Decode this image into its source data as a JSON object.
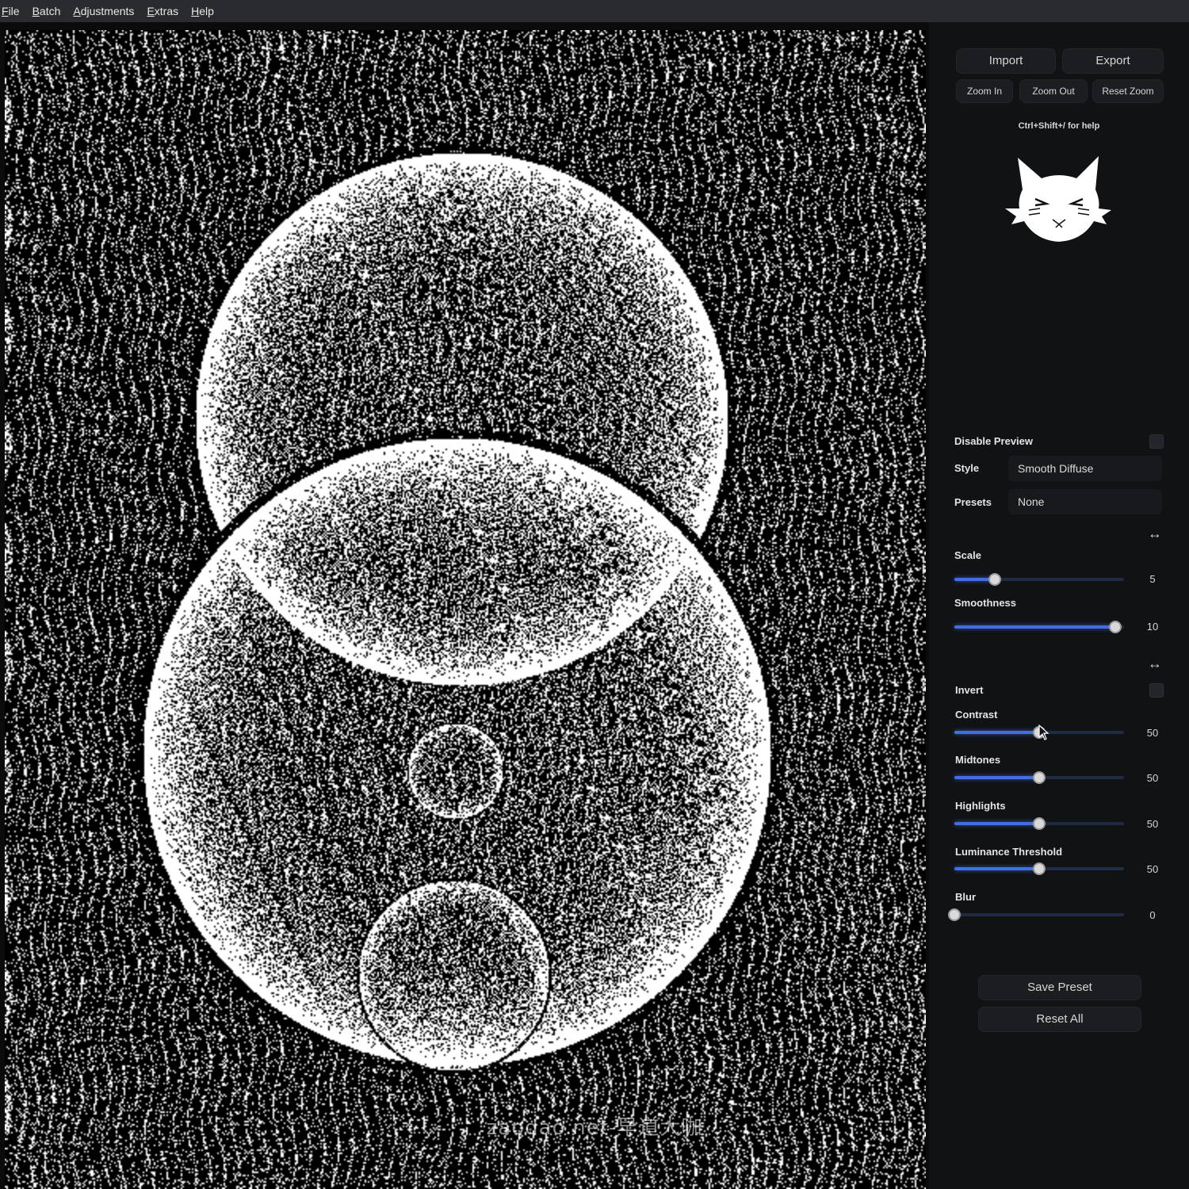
{
  "menu": [
    "File",
    "Batch",
    "Adjustments",
    "Extras",
    "Help"
  ],
  "toolbar": {
    "import": "Import",
    "export": "Export",
    "zoom_in": "Zoom In",
    "zoom_out": "Zoom Out",
    "reset_zoom": "Reset Zoom"
  },
  "help_text": "Ctrl+Shift+/ for help",
  "logo_icon": "cat-face-icon",
  "settings": {
    "disable_preview_label": "Disable Preview",
    "disable_preview_checked": false,
    "style_label": "Style",
    "style_value": "Smooth Diffuse",
    "presets_label": "Presets",
    "presets_value": "None",
    "invert_label": "Invert",
    "invert_checked": false
  },
  "sliders": [
    {
      "key": "scale",
      "label": "Scale",
      "value": "5",
      "fraction": 0.24
    },
    {
      "key": "smoothness",
      "label": "Smoothness",
      "value": "10",
      "fraction": 0.95
    },
    {
      "key": "contrast",
      "label": "Contrast",
      "value": "50",
      "fraction": 0.5
    },
    {
      "key": "midtones",
      "label": "Midtones",
      "value": "50",
      "fraction": 0.5
    },
    {
      "key": "highlights",
      "label": "Highlights",
      "value": "50",
      "fraction": 0.5
    },
    {
      "key": "luminance",
      "label": "Luminance Threshold",
      "value": "50",
      "fraction": 0.5
    },
    {
      "key": "blur",
      "label": "Blur",
      "value": "0",
      "fraction": 0.0
    }
  ],
  "actions": {
    "save_preset": "Save Preset",
    "reset_all": "Reset All"
  },
  "watermark": "zaodao.net-早道大咖",
  "colors": {
    "accent": "#3f6fe0",
    "panel_bg": "#111214",
    "button_bg": "#1c1d21"
  }
}
